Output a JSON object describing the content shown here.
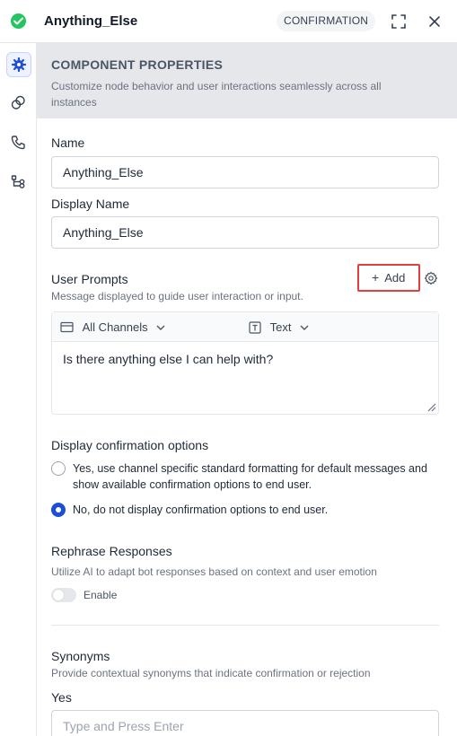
{
  "header": {
    "title": "Anything_Else",
    "badge": "CONFIRMATION",
    "status_icon": "check-circle-icon",
    "expand_icon": "expand-icon",
    "close_icon": "close-icon"
  },
  "left_rail": {
    "items": [
      {
        "icon": "gear-icon",
        "active": true
      },
      {
        "icon": "link-icon",
        "active": false
      },
      {
        "icon": "phone-icon",
        "active": false
      },
      {
        "icon": "flow-icon",
        "active": false
      }
    ]
  },
  "component": {
    "title": "COMPONENT PROPERTIES",
    "description": "Customize node behavior and user interactions seamlessly across all instances"
  },
  "fields": {
    "name_label": "Name",
    "name_value": "Anything_Else",
    "display_name_label": "Display Name",
    "display_name_value": "Anything_Else"
  },
  "user_prompts": {
    "label": "User Prompts",
    "description": "Message displayed to guide user interaction or input.",
    "add_label": "Add",
    "channel": "All Channels",
    "format": "Text",
    "prompt_text": "Is there anything else I can help with?"
  },
  "confirmation": {
    "label": "Display confirmation options",
    "options": [
      {
        "label": "Yes, use channel specific standard formatting for default messages and show available confirmation options to end user.",
        "checked": false
      },
      {
        "label": "No, do not display confirmation options to end user.",
        "checked": true
      }
    ]
  },
  "rephrase": {
    "label": "Rephrase Responses",
    "description": "Utilize AI to adapt bot responses based on context and user emotion",
    "toggle_label": "Enable",
    "enabled": false
  },
  "synonyms": {
    "label": "Synonyms",
    "description": "Provide contextual synonyms that indicate confirmation or rejection",
    "yes_label": "Yes",
    "yes_placeholder": "Type and Press Enter"
  },
  "colors": {
    "accent": "#1d4ed8",
    "success": "#22c55e",
    "highlight": "#e53e3e"
  }
}
